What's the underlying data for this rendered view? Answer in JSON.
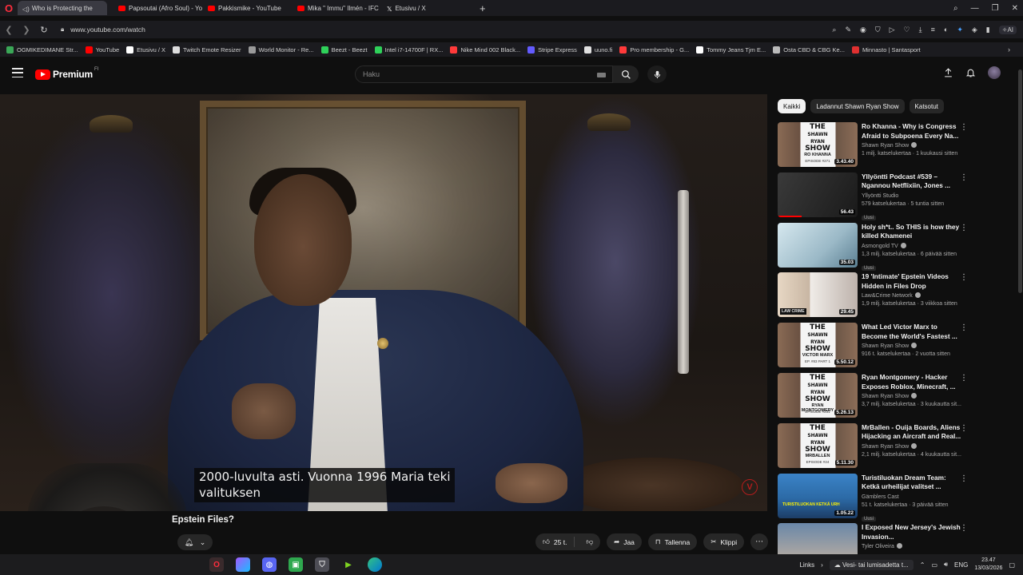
{
  "browser": {
    "tabs": [
      {
        "label": "Who is Protecting the",
        "active": true
      },
      {
        "label": "Papsoutai (Afro Soul) - Yo",
        "active": false
      },
      {
        "label": "Pakkismike - YouTube",
        "active": false
      },
      {
        "label": "Mika \" Immu\" Ilmén - IFC",
        "active": false
      },
      {
        "label": "Etusivu / X",
        "active": false
      }
    ],
    "new_tab": "+",
    "url": "www.youtube.com/watch",
    "ai_label": "AI",
    "bookmarks": [
      {
        "label": "OGMIKEDIMANE Str...",
        "color": "#3aa757"
      },
      {
        "label": "YouTube",
        "color": "#ff0000"
      },
      {
        "label": "Etusivu / X",
        "color": "#ffffff"
      },
      {
        "label": "Twitch Emote Resizer",
        "color": "#dddddd"
      },
      {
        "label": "World Monitor - Re...",
        "color": "#9a9a9a"
      },
      {
        "label": "Beezt - Beezt",
        "color": "#2fd15a"
      },
      {
        "label": "Intel i7-14700F | RX...",
        "color": "#2fd15a"
      },
      {
        "label": "Nike Mind 002 Black...",
        "color": "#ff3a3a"
      },
      {
        "label": "Stripe Express",
        "color": "#635bff"
      },
      {
        "label": "uuno.fi",
        "color": "#e0e0e0"
      },
      {
        "label": "Pro membership - G...",
        "color": "#ff3a3a"
      },
      {
        "label": "Tommy Jeans Tjm E...",
        "color": "#ffffff"
      },
      {
        "label": "Osta CBD & CBG Ke...",
        "color": "#bbbbbb"
      },
      {
        "label": "Minnasto | Santasport",
        "color": "#e03030"
      }
    ]
  },
  "youtube": {
    "logo_text": "Premium",
    "logo_country": "FI",
    "search_placeholder": "Haku",
    "subtitle_line1": "2000-luvulta asti.  Vuonna 1996 Maria teki",
    "subtitle_line2": "valituksen",
    "video_title_partial": "Epstein Files?",
    "actions": {
      "likes": "25 t.",
      "share": "Jaa",
      "save": "Tallenna",
      "clip": "Klippi"
    },
    "chips": [
      {
        "label": "Kaikki",
        "active": true
      },
      {
        "label": "Ladannut Shawn Ryan Show",
        "active": false
      },
      {
        "label": "Katsotut",
        "active": false
      }
    ],
    "recommendations": [
      {
        "title": "Ro Khanna - Why is Congress Afraid to Subpoena Every Na...",
        "channel": "Shawn Ryan Show",
        "verified": true,
        "views": "1 milj. katselukertaa · 1 kuukausi sitten",
        "duration": "3.43.40",
        "thumb": "show",
        "guest": "RO KHANNA",
        "ep": "EPISODE #271",
        "is_new": false,
        "progress": 0
      },
      {
        "title": "Yllyöntti Podcast #539 – Ngannou Netflixiin, Jones ...",
        "channel": "Yllyöntti Studio",
        "verified": false,
        "views": "579 katselukertaa · 5 tuntia sitten",
        "duration": "56.43",
        "thumb": "podcast",
        "is_new": true,
        "progress": 0.3
      },
      {
        "title": "Holy sh*t.. So THIS is how they killed Khamenei",
        "channel": "Asmongold TV",
        "verified": true,
        "views": "1,3 milj. katselukertaa · 6 päivää sitten",
        "duration": "35.03",
        "thumb": "hamster",
        "is_new": true,
        "progress": 0
      },
      {
        "title": "19 'Intimate' Epstein Videos Hidden in Files Drop",
        "channel": "Law&Crime Network",
        "verified": true,
        "views": "1,9 milj. katselukertaa · 3 viikkoa sitten",
        "duration": "29.45",
        "thumb": "epstein",
        "law": "LAW CRIME",
        "is_new": false,
        "progress": 0
      },
      {
        "title": "What Led Victor Marx to Become the World's Fastest ...",
        "channel": "Shawn Ryan Show",
        "verified": true,
        "views": "916 t. katselukertaa · 2 vuotta sitten",
        "duration": "5.50.12",
        "thumb": "show",
        "guest": "VICTOR MARX",
        "ep": "EP. #83 PART 1",
        "is_new": false,
        "progress": 0
      },
      {
        "title": "Ryan Montgomery - Hacker Exposes Roblox, Minecraft, ...",
        "channel": "Shawn Ryan Show",
        "verified": true,
        "views": "3,7 milj. katselukertaa · 3 kuukautta sit...",
        "duration": "5.26.13",
        "thumb": "show",
        "guest": "RYAN MONTGOMERY",
        "ep": "EPISODE #231",
        "is_new": false,
        "progress": 0
      },
      {
        "title": "MrBallen - Ouija Boards, Aliens Hijacking an Aircraft and Real...",
        "channel": "Shawn Ryan Show",
        "verified": true,
        "views": "2,1 milj. katselukertaa · 4 kuukautta sit...",
        "duration": "5.11.30",
        "thumb": "show",
        "guest": "MRBALLEN",
        "ep": "EPISODE #24",
        "is_new": false,
        "progress": 0
      },
      {
        "title": "Turistiluokan Dream Team: Ketkä urheilijat valitset ...",
        "channel": "Gämblers Cast",
        "verified": false,
        "views": "51 t. katselukertaa · 3 päivää sitten",
        "duration": "1.05.22",
        "thumb": "turisti",
        "tx": "TURISTILUOKAN KETKÄ URH",
        "is_new": true,
        "progress": 0
      },
      {
        "title": "I Exposed New Jersey's Jewish Invasion...",
        "channel": "Tyler Oliveira",
        "verified": true,
        "views": "",
        "duration": "",
        "thumb": "nj",
        "is_new": false,
        "progress": 0
      }
    ]
  },
  "taskbar": {
    "links_label": "Links",
    "weather": "Vesi- tai lumisadetta t...",
    "lang": "ENG",
    "time": "23.47",
    "date": "13/03/2026"
  }
}
